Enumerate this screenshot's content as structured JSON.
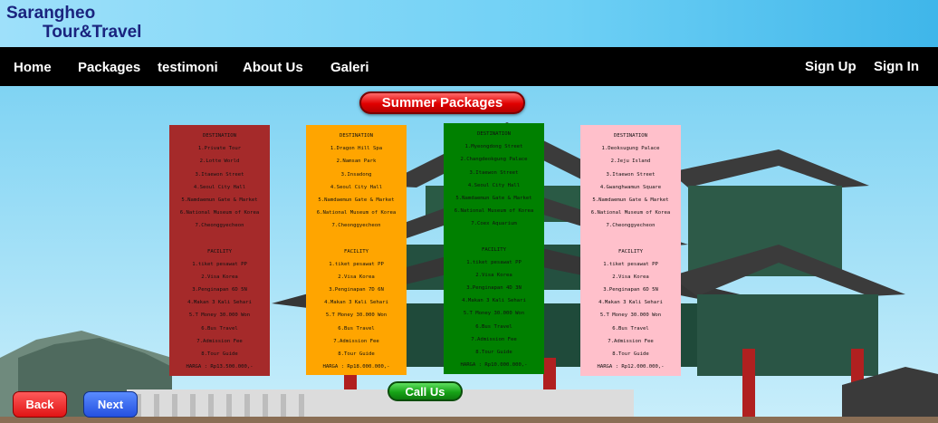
{
  "brand": {
    "line1": "Sarangheo",
    "line2": "Tour&Travel"
  },
  "nav": {
    "home": "Home",
    "packages": "Packages",
    "testimoni": "testimoni",
    "about": "About Us",
    "galeri": "Galeri",
    "signup": "Sign Up",
    "signin": "Sign In"
  },
  "title": "Summer Packages",
  "packages": [
    {
      "destination_title": "DESTINATION",
      "destinations": [
        "1.Private Tour",
        "2.Lotte World",
        "3.Itaewon Street",
        "4.Seoul City Hall",
        "5.Namdaemun Gate & Market",
        "6.National Museum of Korea",
        "7.Cheonggyecheon"
      ],
      "facility_title": "FACILITY",
      "facilities": [
        "1.tiket pesawat PP",
        "2.Visa Korea",
        "3.Penginapan 6D 5N",
        "4.Makan 3 Kali Sehari",
        "5.T Money 30.000 Won",
        "6.Bus Travel",
        "7.Admission Fee",
        "8.Tour Guide"
      ],
      "price": "HARGA : Rp13.500.000,-"
    },
    {
      "destination_title": "DESTINATION",
      "destinations": [
        "1.Dragon Hill Spa",
        "2.Namsan Park",
        "3.Insadong",
        "4.Seoul City Hall",
        "5.Namdaemun Gate & Market",
        "6.National Museum of Korea",
        "7.Cheonggyecheon"
      ],
      "facility_title": "FACILITY",
      "facilities": [
        "1.tiket pesawat PP",
        "2.Visa Korea",
        "3.Penginapan 7D 6N",
        "4.Makan 3 Kali Sehari",
        "5.T Money 30.000 Won",
        "6.Bus Travel",
        "7.Admission Fee",
        "8.Tour Guide"
      ],
      "price": "HARGA : Rp18.000.000,-"
    },
    {
      "destination_title": "DESTINATION",
      "destinations": [
        "1.Myeongdong Street",
        "2.Changdeokgung Palace",
        "3.Itaewon Street",
        "4.Seoul City Hall",
        "5.Namdaemun Gate & Market",
        "6.National Museum of Korea",
        "7.Coex Aquarium"
      ],
      "facility_title": "FACILITY",
      "facilities": [
        "1.tiket pesawat PP",
        "2.Visa Korea",
        "3.Penginapan 4D 3N",
        "4.Makan 3 Kali Sehari",
        "5.T Money 30.000 Won",
        "6.Bus Travel",
        "7.Admission Fee",
        "8.Tour Guide"
      ],
      "price": "HARGA : Rp10.000.000,-"
    },
    {
      "destination_title": "DESTINATION",
      "destinations": [
        "1.Deoksugung Palace",
        "2.Jeju Island",
        "3.Itaewon Street",
        "4.Gwanghwamun Square",
        "5.Namdaemun Gate & Market",
        "6.National Museum of Korea",
        "7.Cheonggyecheon"
      ],
      "facility_title": "FACILITY",
      "facilities": [
        "1.tiket pesawat PP",
        "2.Visa Korea",
        "3.Penginapan 6D 5N",
        "4.Makan 3 Kali Sehari",
        "5.T Money 30.000 Won",
        "6.Bus Travel",
        "7.Admission Fee",
        "8.Tour Guide"
      ],
      "price": "HARGA : Rp12.000.000,-"
    }
  ],
  "buttons": {
    "call": "Call Us",
    "back": "Back",
    "next": "Next"
  }
}
